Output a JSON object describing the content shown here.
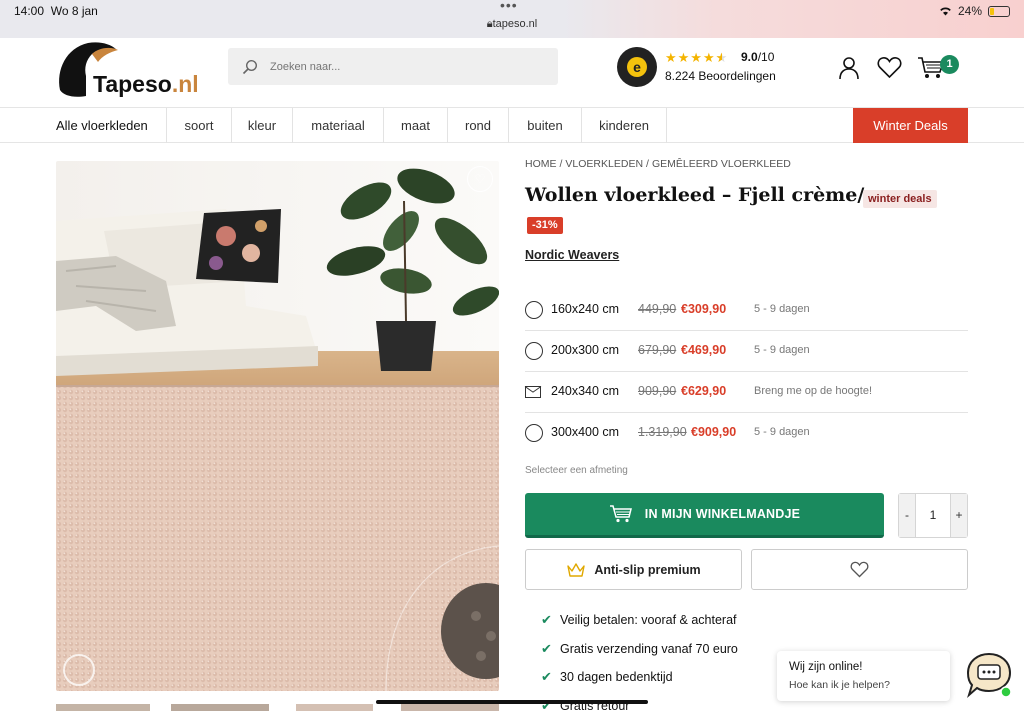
{
  "status_bar": {
    "time": "14:00",
    "date": "Wo 8 jan",
    "url": "tapeso.nl",
    "battery": "24%",
    "battery_level": 0.24
  },
  "header": {
    "logo_text": "Tapeso",
    "logo_suffix": ".nl",
    "search_placeholder": "Zoeken naar...",
    "rating_score": "9.0",
    "rating_max": "/10",
    "rating_stars": 4.5,
    "reviews": "8.224 Beoordelingen",
    "cart_count": "1"
  },
  "nav": {
    "items": [
      "Alle vloerkleden",
      "soort",
      "kleur",
      "materiaal",
      "maat",
      "rond",
      "buiten",
      "kinderen"
    ],
    "deals_label": "Winter Deals"
  },
  "product": {
    "breadcrumb": [
      "HOME",
      "VLOERKLEDEN",
      "GEMÊLEERD VLOERKLEED"
    ],
    "title": "Wollen vloerkleed – Fjell crème/roze",
    "tag": "winter deals",
    "discount": "-31%",
    "brand": "Nordic Weavers",
    "sizes": [
      {
        "label": "160x240 cm",
        "old": "449,90",
        "new": "€309,90",
        "delivery": "5 - 9 dagen",
        "available": true
      },
      {
        "label": "200x300 cm",
        "old": "679,90",
        "new": "€469,90",
        "delivery": "5 - 9 dagen",
        "available": true
      },
      {
        "label": "240x340 cm",
        "old": "909,90",
        "new": "€629,90",
        "delivery": "Breng me op de hoogte!",
        "available": false
      },
      {
        "label": "300x400 cm",
        "old": "1.319,90",
        "new": "€909,90",
        "delivery": "5 - 9 dagen",
        "available": true
      }
    ],
    "size_hint": "Selecteer een afmeting",
    "cart_button": "IN MIJN WINKELMANDJE",
    "quantity": "1",
    "qty_minus": "-",
    "qty_plus": "+",
    "antislip_button": "Anti-slip premium",
    "usps": [
      "Veilig betalen: vooraf & achteraf",
      "Gratis verzending vanaf 70 euro",
      "30 dagen bedenktijd",
      "Gratis retour"
    ]
  },
  "chat": {
    "line1": "Wij zijn online!",
    "line2": "Hoe kan ik je helpen?"
  },
  "colors": {
    "brand_green": "#1a8a5e",
    "deal_red": "#d93e29",
    "logo_orange": "#c9853d"
  }
}
